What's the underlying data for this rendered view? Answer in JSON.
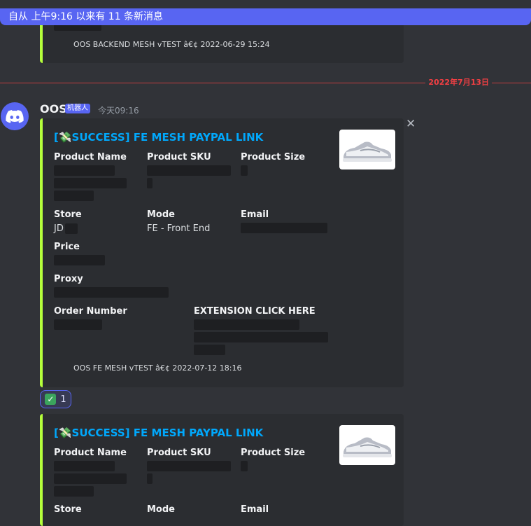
{
  "new_messages_bar": {
    "text": "自从 上午9:16 以来有 11 条新消息"
  },
  "previous_embed": {
    "footer": "OOS BACKEND MESH vTEST â€¢ 2022-06-29 15:24"
  },
  "date_divider": {
    "label": "2022年7月13日"
  },
  "message": {
    "author": "OOS",
    "bot_tag": "机器人",
    "timestamp": "今天09:16"
  },
  "embed1": {
    "title_open": "[",
    "title": "SUCCESS] FE MESH PAYPAL LINK",
    "fields": {
      "product_name": "Product Name",
      "product_sku": "Product SKU",
      "product_size": "Product Size",
      "store": "Store",
      "store_value": "JD",
      "mode": "Mode",
      "mode_value": "FE - Front End",
      "email": "Email",
      "price": "Price",
      "proxy": "Proxy",
      "order_number": "Order Number",
      "extension": "EXTENSION CLICK HERE"
    },
    "footer": "OOS FE MESH vTEST â€¢ 2022-07-12 18:16"
  },
  "reaction": {
    "emoji": "✓",
    "count": "1"
  },
  "embed2": {
    "title_open": "[",
    "title": "SUCCESS] FE MESH PAYPAL LINK",
    "fields": {
      "product_name": "Product Name",
      "product_sku": "Product SKU",
      "product_size": "Product Size",
      "store": "Store",
      "mode": "Mode",
      "email": "Email"
    }
  },
  "colors": {
    "background": "#313338",
    "embed_background": "#2b2d31",
    "embed_border": "#b5ff3b",
    "title_link": "#00a8fc",
    "new_messages_bar": "#5865f2",
    "date_divider": "#f23f43"
  },
  "icons": [
    "discord-logo-icon",
    "close-icon",
    "money-icon",
    "sneaker-thumbnail",
    "check-mark-icon"
  ]
}
